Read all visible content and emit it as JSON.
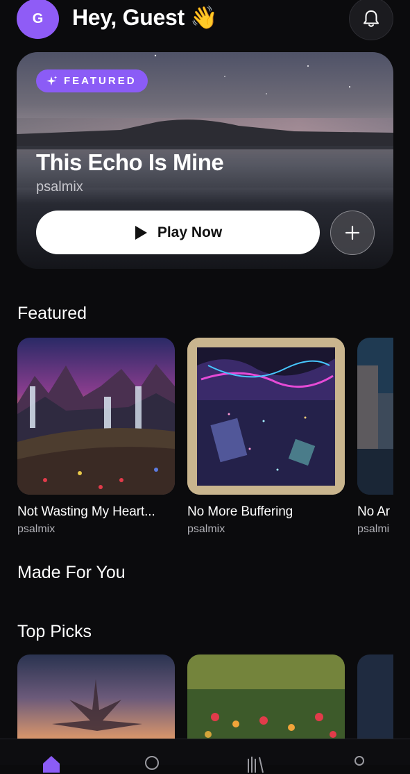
{
  "header": {
    "avatar_initial": "G",
    "greeting": "Hey, Guest 👋"
  },
  "hero": {
    "badge": "FEATURED",
    "title": "This Echo Is Mine",
    "artist": "psalmix",
    "play_label": "Play Now"
  },
  "sections": {
    "featured": "Featured",
    "made_for_you": "Made For You",
    "top_picks": "Top Picks"
  },
  "featured_cards": [
    {
      "title": "Not Wasting My Heart...",
      "artist": "psalmix"
    },
    {
      "title": "No More Buffering",
      "artist": "psalmix"
    },
    {
      "title": "No Ar",
      "artist": "psalmi"
    }
  ],
  "colors": {
    "accent": "#8b5cf6",
    "background": "#0b0b0d"
  },
  "icons": {
    "bell": "bell-icon",
    "sparkle": "sparkle-icon",
    "play": "play-icon",
    "plus": "plus-icon",
    "home": "home-icon",
    "search": "search-icon",
    "library": "library-icon",
    "profile": "profile-icon"
  }
}
